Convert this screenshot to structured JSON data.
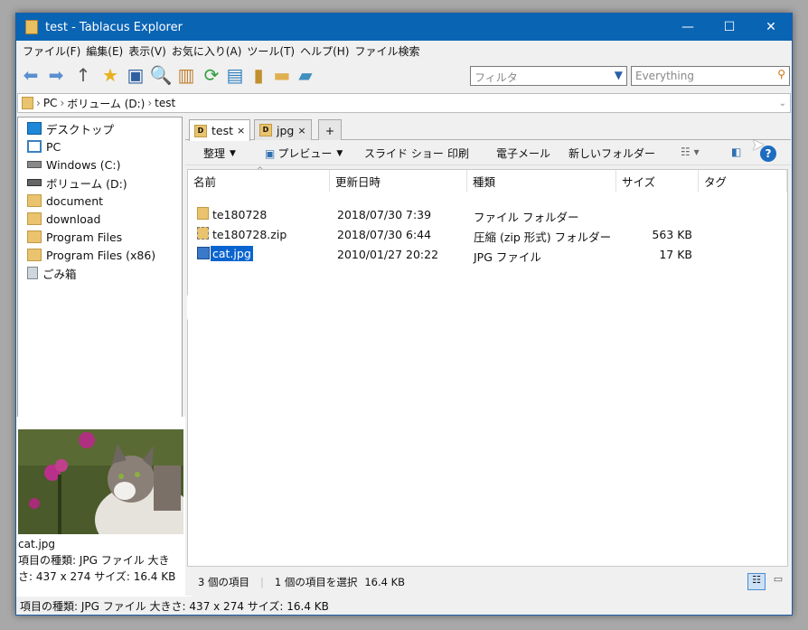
{
  "window": {
    "title": "test - Tablacus Explorer",
    "min": "—",
    "max": "☐",
    "close": "✕"
  },
  "menu": [
    "ファイル(F)",
    "編集(E)",
    "表示(V)",
    "お気に入り(A)",
    "ツール(T)",
    "ヘルプ(H)",
    "ファイル検索"
  ],
  "filter": {
    "placeholder": "フィルタ",
    "search_placeholder": "Everything"
  },
  "address": {
    "parts": [
      "PC",
      "ボリューム (D:)",
      "test"
    ],
    "sep": "›"
  },
  "tree": [
    {
      "label": "デスクトップ",
      "icon": "desktop-icon"
    },
    {
      "label": "PC",
      "icon": "pc-icon"
    },
    {
      "label": "Windows (C:)",
      "icon": "drive-icon"
    },
    {
      "label": "ボリューム (D:)",
      "icon": "drive-icon"
    },
    {
      "label": "document",
      "icon": "folder-icon"
    },
    {
      "label": "download",
      "icon": "folder-icon"
    },
    {
      "label": "Program Files",
      "icon": "folder-icon"
    },
    {
      "label": "Program Files (x86)",
      "icon": "folder-icon"
    },
    {
      "label": "ごみ箱",
      "icon": "recycle-bin-icon"
    }
  ],
  "preview": {
    "name": "cat.jpg",
    "info": "項目の種類: JPG ファイル 大きさ: 437 x 274 サイズ: 16.4 KB"
  },
  "tabs": [
    {
      "label": "test",
      "close": "×"
    },
    {
      "label": "jpg",
      "close": "×"
    },
    {
      "label": "+"
    }
  ],
  "commands": {
    "organize": "整理",
    "preview": "プレビュー",
    "slideshow": "スライド ショー",
    "print": "印刷",
    "email": "電子メール",
    "newfolder": "新しいフォルダー"
  },
  "columns": [
    "名前",
    "更新日時",
    "種類",
    "サイズ",
    "タグ"
  ],
  "files": [
    {
      "name": "te180728",
      "date": "2018/07/30 7:39",
      "type": "ファイル フォルダー",
      "size": ""
    },
    {
      "name": "te180728.zip",
      "date": "2018/07/30 6:44",
      "type": "圧縮 (zip 形式) フォルダー",
      "size": "563 KB"
    },
    {
      "name": "cat.jpg",
      "date": "2010/01/27 20:22",
      "type": "JPG ファイル",
      "size": "17 KB"
    }
  ],
  "status": {
    "count": "3 個の項目",
    "selected": "1 個の項目を選択",
    "selsize": "16.4 KB",
    "bottom": "項目の種類: JPG ファイル 大きさ: 437 x 274 サイズ: 16.4 KB"
  }
}
